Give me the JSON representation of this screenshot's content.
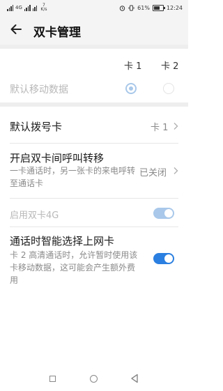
{
  "status_bar": {
    "network_type": "4G",
    "speed_value": "7",
    "speed_unit": "K/s",
    "battery_percent": "61%",
    "time": "12:24"
  },
  "header": {
    "title": "双卡管理"
  },
  "sim_columns": {
    "card1": "卡 1",
    "card2": "卡 2"
  },
  "default_data": {
    "label": "默认移动数据",
    "selected": "card1"
  },
  "default_dial": {
    "label": "默认拨号卡",
    "value": "卡 1"
  },
  "call_forward": {
    "label": "开启双卡间呼叫转移",
    "description": "一卡通话时，另一张卡的来电呼转至通话卡",
    "value": "已关闭"
  },
  "dual_4g": {
    "label": "启用双卡4G",
    "enabled": true
  },
  "smart_data": {
    "label": "通话时智能选择上网卡",
    "description": "卡 2 高清通话时，允许暂时使用该卡移动数据，这可能会产生额外费用",
    "enabled": true
  },
  "colors": {
    "accent": "#2b7fe0",
    "accent_disabled": "#a9c8ea"
  }
}
